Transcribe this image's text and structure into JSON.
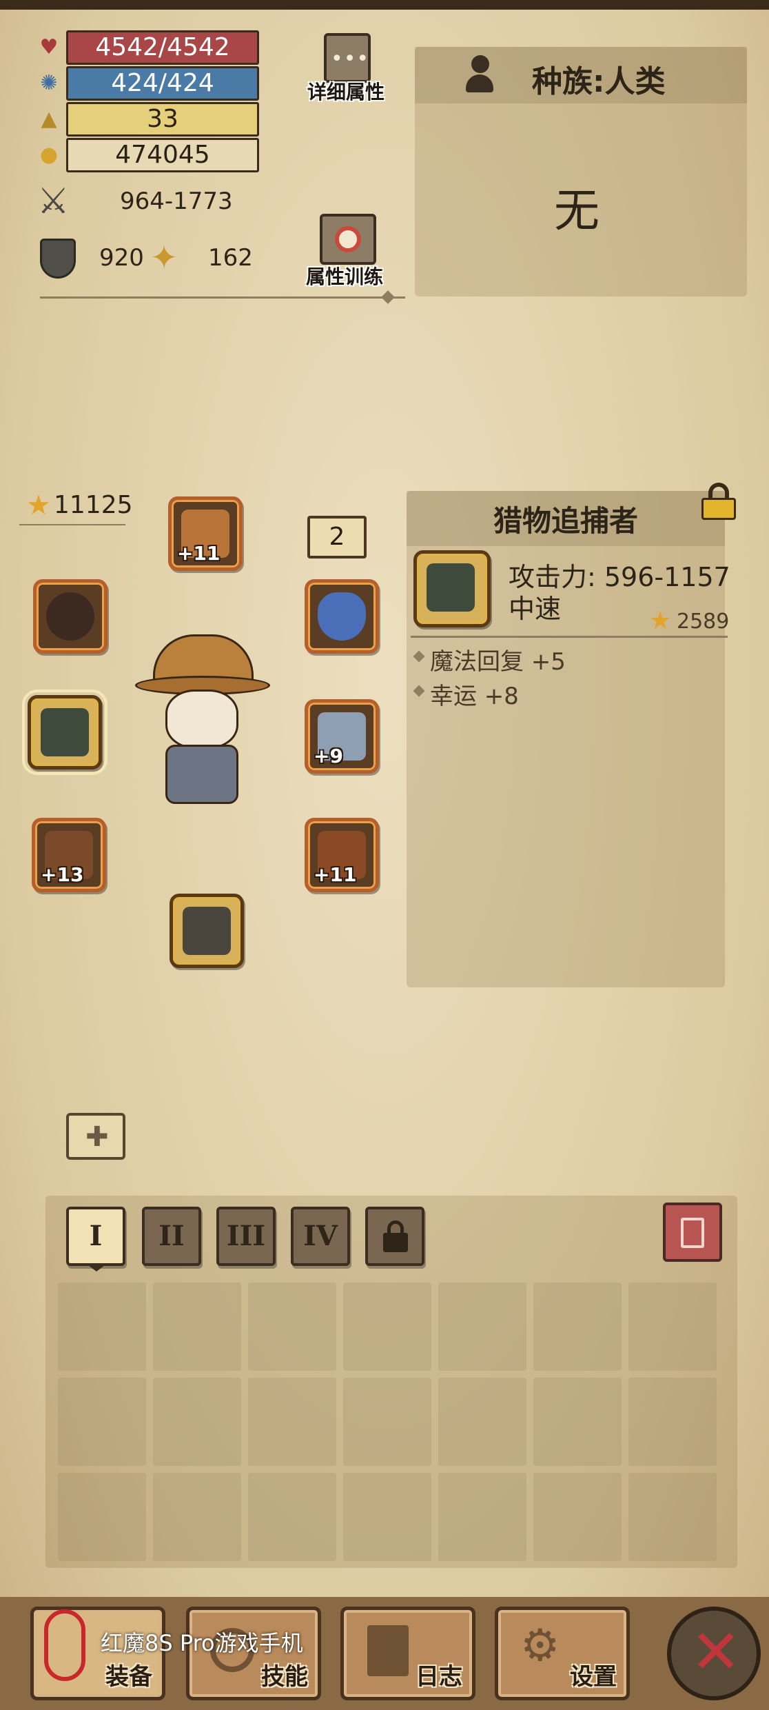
{
  "stats": {
    "hp": "4542/4542",
    "mp": "424/424",
    "level": "33",
    "gold": "474045",
    "attack": "964-1773",
    "defense": "920",
    "magic": "162"
  },
  "buttons": {
    "detail_attrs": "详细属性",
    "attr_training": "属性训练"
  },
  "race_panel": {
    "race": "种族:人类",
    "value": "无"
  },
  "equipment": {
    "score": "11125",
    "level_badge": "2",
    "slots": [
      {
        "name": "hat",
        "plus": "+11"
      },
      {
        "name": "ring",
        "plus": ""
      },
      {
        "name": "amulet",
        "plus": ""
      },
      {
        "name": "weapon",
        "plus": ""
      },
      {
        "name": "armor",
        "plus": "+9"
      },
      {
        "name": "gloves",
        "plus": "+13"
      },
      {
        "name": "belt",
        "plus": "+11"
      },
      {
        "name": "boots",
        "plus": ""
      }
    ]
  },
  "item_panel": {
    "title": "猎物追捕者",
    "attack": "攻击力: 596-1157",
    "speed": "中速",
    "score": "2589",
    "bonuses": [
      "魔法回复 +5",
      "幸运 +8"
    ]
  },
  "bag_tabs": [
    "I",
    "II",
    "III",
    "IV"
  ],
  "nav": {
    "equip": "装备",
    "skills": "技能",
    "log": "日志",
    "settings": "设置"
  },
  "watermark": "红魔8S Pro游戏手机",
  "colors": {
    "hp": "#a84648",
    "mp": "#4a7aa6",
    "level": "#e6cf7a",
    "slot_border": "#b5602c",
    "close": "#c0363a"
  }
}
